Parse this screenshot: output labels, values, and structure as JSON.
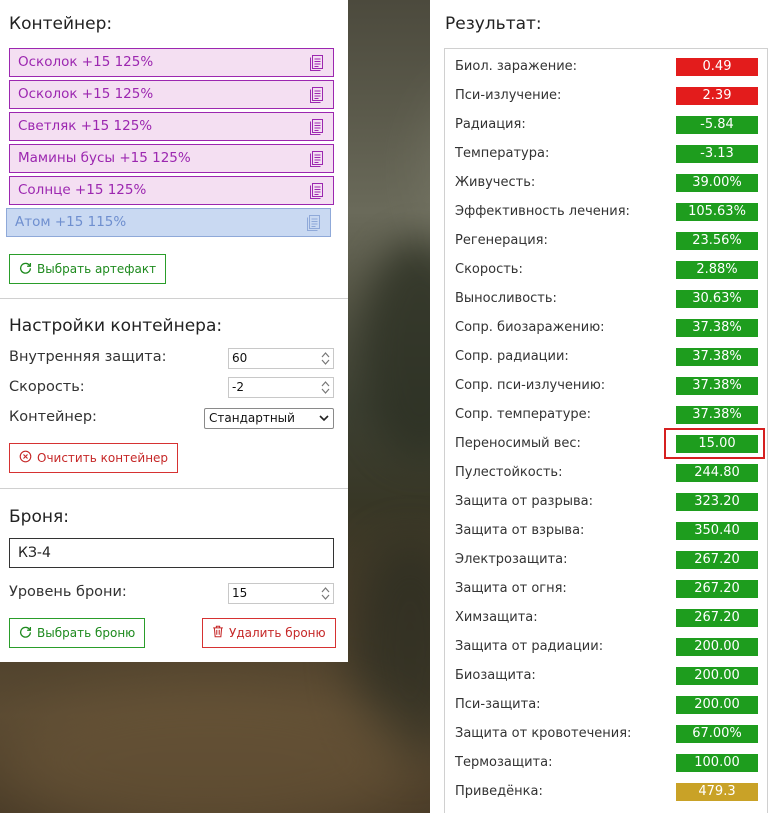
{
  "container": {
    "title": "Контейнер:",
    "artifacts": [
      {
        "label": "Осколок +15 125%",
        "style": "pink"
      },
      {
        "label": "Осколок +15 125%",
        "style": "pink"
      },
      {
        "label": "Светляк +15 125%",
        "style": "pink"
      },
      {
        "label": "Мамины бусы +15 125%",
        "style": "pink"
      },
      {
        "label": "Солнце +15 125%",
        "style": "pink"
      },
      {
        "label": "Атом +15 115%",
        "style": "blue"
      }
    ],
    "select_artifact_button": "Выбрать артефакт"
  },
  "settings": {
    "title": "Настройки контейнера:",
    "internal_protection_label": "Внутренняя защита:",
    "internal_protection_value": "60",
    "speed_label": "Скорость:",
    "speed_value": "-2",
    "container_label": "Контейнер:",
    "container_value": "Стандартный",
    "clear_button": "Очистить контейнер"
  },
  "armor": {
    "title": "Броня:",
    "name_value": "КЗ-4",
    "level_label": "Уровень брони:",
    "level_value": "15",
    "select_button": "Выбрать броню",
    "delete_button": "Удалить броню"
  },
  "result": {
    "title": "Результат:",
    "highlighted_index": 13,
    "rows": [
      {
        "label": "Биол. заражение:",
        "value": "0.49",
        "color": "red"
      },
      {
        "label": "Пси-излучение:",
        "value": "2.39",
        "color": "red"
      },
      {
        "label": "Радиация:",
        "value": "-5.84",
        "color": "green"
      },
      {
        "label": "Температура:",
        "value": "-3.13",
        "color": "green"
      },
      {
        "label": "Живучесть:",
        "value": "39.00%",
        "color": "green"
      },
      {
        "label": "Эффективность лечения:",
        "value": "105.63%",
        "color": "green"
      },
      {
        "label": "Регенерация:",
        "value": "23.56%",
        "color": "green"
      },
      {
        "label": "Скорость:",
        "value": "2.88%",
        "color": "green"
      },
      {
        "label": "Выносливость:",
        "value": "30.63%",
        "color": "green"
      },
      {
        "label": "Сопр. биозаражению:",
        "value": "37.38%",
        "color": "green"
      },
      {
        "label": "Сопр. радиации:",
        "value": "37.38%",
        "color": "green"
      },
      {
        "label": "Сопр. пси-излучению:",
        "value": "37.38%",
        "color": "green"
      },
      {
        "label": "Сопр. температуре:",
        "value": "37.38%",
        "color": "green"
      },
      {
        "label": "Переносимый вес:",
        "value": "15.00",
        "color": "green"
      },
      {
        "label": "Пулестойкость:",
        "value": "244.80",
        "color": "green"
      },
      {
        "label": "Защита от разрыва:",
        "value": "323.20",
        "color": "green"
      },
      {
        "label": "Защита от взрыва:",
        "value": "350.40",
        "color": "green"
      },
      {
        "label": "Электрозащита:",
        "value": "267.20",
        "color": "green"
      },
      {
        "label": "Защита от огня:",
        "value": "267.20",
        "color": "green"
      },
      {
        "label": "Химзащита:",
        "value": "267.20",
        "color": "green"
      },
      {
        "label": "Защита от радиации:",
        "value": "200.00",
        "color": "green"
      },
      {
        "label": "Биозащита:",
        "value": "200.00",
        "color": "green"
      },
      {
        "label": "Пси-защита:",
        "value": "200.00",
        "color": "green"
      },
      {
        "label": "Защита от кровотечения:",
        "value": "67.00%",
        "color": "green"
      },
      {
        "label": "Термозащита:",
        "value": "100.00",
        "color": "green"
      },
      {
        "label": "Приведёнка:",
        "value": "479.3",
        "color": "gold"
      }
    ]
  },
  "colors": {
    "artifact_pink_bg": "#f4dff2",
    "artifact_pink_border": "#9c27b0",
    "artifact_blue_bg": "#c9d9f2",
    "status_red": "#e31c1c",
    "status_green": "#1e9d1e",
    "status_gold": "#c9a227",
    "highlight_border": "#d62020"
  }
}
